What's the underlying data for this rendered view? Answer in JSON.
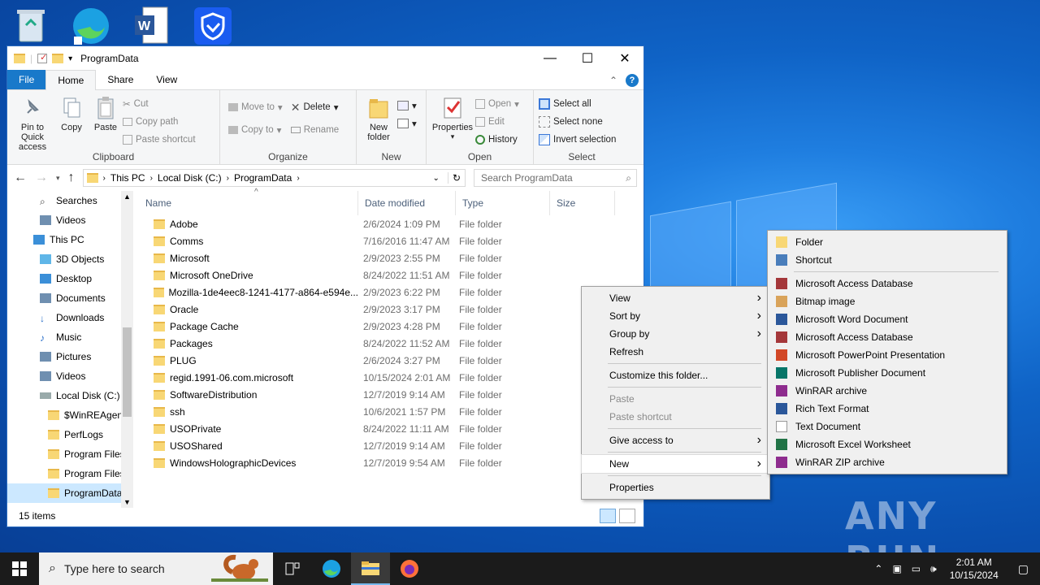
{
  "window": {
    "title": "ProgramData",
    "minimize": "—",
    "maximize": "☐",
    "close": "✕"
  },
  "tabs": {
    "file": "File",
    "home": "Home",
    "share": "Share",
    "view": "View",
    "help": "?"
  },
  "ribbon": {
    "clipboard": {
      "label": "Clipboard",
      "pin": "Pin to Quick access",
      "copy": "Copy",
      "paste": "Paste",
      "cut": "Cut",
      "copy_path": "Copy path",
      "paste_shortcut": "Paste shortcut"
    },
    "organize": {
      "label": "Organize",
      "move_to": "Move to",
      "copy_to": "Copy to",
      "delete": "Delete",
      "rename": "Rename"
    },
    "new": {
      "label": "New",
      "new_folder": "New folder"
    },
    "open": {
      "label": "Open",
      "properties": "Properties",
      "open": "Open",
      "edit": "Edit",
      "history": "History"
    },
    "select": {
      "label": "Select",
      "select_all": "Select all",
      "select_none": "Select none",
      "invert": "Invert selection"
    }
  },
  "address": {
    "crumbs": [
      "This PC",
      "Local Disk (C:)",
      "ProgramData"
    ],
    "search_placeholder": "Search ProgramData"
  },
  "nav": [
    {
      "label": "Searches",
      "indent": 40,
      "icon": "search-icon"
    },
    {
      "label": "Videos",
      "indent": 40,
      "icon": "videos-icon"
    },
    {
      "label": "This PC",
      "indent": 32,
      "icon": "pc-icon"
    },
    {
      "label": "3D Objects",
      "indent": 40,
      "icon": "cube-icon"
    },
    {
      "label": "Desktop",
      "indent": 40,
      "icon": "desktop-icon"
    },
    {
      "label": "Documents",
      "indent": 40,
      "icon": "documents-icon"
    },
    {
      "label": "Downloads",
      "indent": 40,
      "icon": "download-icon"
    },
    {
      "label": "Music",
      "indent": 40,
      "icon": "music-icon"
    },
    {
      "label": "Pictures",
      "indent": 40,
      "icon": "pictures-icon"
    },
    {
      "label": "Videos",
      "indent": 40,
      "icon": "videos-icon"
    },
    {
      "label": "Local Disk (C:)",
      "indent": 40,
      "icon": "drive-icon"
    },
    {
      "label": "$WinREAgent",
      "indent": 50,
      "icon": "folder-icon"
    },
    {
      "label": "PerfLogs",
      "indent": 50,
      "icon": "folder-icon"
    },
    {
      "label": "Program Files",
      "indent": 50,
      "icon": "folder-icon"
    },
    {
      "label": "Program Files",
      "indent": 50,
      "icon": "folder-icon"
    },
    {
      "label": "ProgramData",
      "indent": 50,
      "icon": "folder-icon",
      "selected": true
    }
  ],
  "columns": {
    "name": "Name",
    "date": "Date modified",
    "type": "Type",
    "size": "Size"
  },
  "files": [
    {
      "name": "Adobe",
      "date": "2/6/2024 1:09 PM",
      "type": "File folder"
    },
    {
      "name": "Comms",
      "date": "7/16/2016 11:47 AM",
      "type": "File folder"
    },
    {
      "name": "Microsoft",
      "date": "2/9/2023 2:55 PM",
      "type": "File folder"
    },
    {
      "name": "Microsoft OneDrive",
      "date": "8/24/2022 11:51 AM",
      "type": "File folder"
    },
    {
      "name": "Mozilla-1de4eec8-1241-4177-a864-e594e...",
      "date": "2/9/2023 6:22 PM",
      "type": "File folder"
    },
    {
      "name": "Oracle",
      "date": "2/9/2023 3:17 PM",
      "type": "File folder"
    },
    {
      "name": "Package Cache",
      "date": "2/9/2023 4:28 PM",
      "type": "File folder"
    },
    {
      "name": "Packages",
      "date": "8/24/2022 11:52 AM",
      "type": "File folder"
    },
    {
      "name": "PLUG",
      "date": "2/6/2024 3:27 PM",
      "type": "File folder"
    },
    {
      "name": "regid.1991-06.com.microsoft",
      "date": "10/15/2024 2:01 AM",
      "type": "File folder"
    },
    {
      "name": "SoftwareDistribution",
      "date": "12/7/2019 9:14 AM",
      "type": "File folder"
    },
    {
      "name": "ssh",
      "date": "10/6/2021 1:57 PM",
      "type": "File folder"
    },
    {
      "name": "USOPrivate",
      "date": "8/24/2022 11:11 AM",
      "type": "File folder"
    },
    {
      "name": "USOShared",
      "date": "12/7/2019 9:14 AM",
      "type": "File folder"
    },
    {
      "name": "WindowsHolographicDevices",
      "date": "12/7/2019 9:54 AM",
      "type": "File folder"
    }
  ],
  "status": "15 items",
  "context_menu": [
    {
      "label": "View",
      "arrow": true
    },
    {
      "label": "Sort by",
      "arrow": true
    },
    {
      "label": "Group by",
      "arrow": true
    },
    {
      "label": "Refresh"
    },
    {
      "sep": true
    },
    {
      "label": "Customize this folder..."
    },
    {
      "sep": true
    },
    {
      "label": "Paste",
      "disabled": true
    },
    {
      "label": "Paste shortcut",
      "disabled": true
    },
    {
      "sep": true
    },
    {
      "label": "Give access to",
      "arrow": true
    },
    {
      "sep": true
    },
    {
      "label": "New",
      "arrow": true,
      "highlight": true
    },
    {
      "sep": true
    },
    {
      "label": "Properties"
    }
  ],
  "new_submenu": [
    {
      "label": "Folder",
      "icon": "folder-icon",
      "color": "#f8d775"
    },
    {
      "label": "Shortcut",
      "icon": "shortcut-icon",
      "color": "#4a7ebb"
    },
    {
      "sep": true
    },
    {
      "label": "Microsoft Access Database",
      "icon": "access-icon",
      "color": "#a4373a"
    },
    {
      "label": "Bitmap image",
      "icon": "bitmap-icon",
      "color": "#d9a35a"
    },
    {
      "label": "Microsoft Word Document",
      "icon": "word-icon",
      "color": "#2b579a"
    },
    {
      "label": "Microsoft Access Database",
      "icon": "access-icon",
      "color": "#a4373a"
    },
    {
      "label": "Microsoft PowerPoint Presentation",
      "icon": "powerpoint-icon",
      "color": "#d24726"
    },
    {
      "label": "Microsoft Publisher Document",
      "icon": "publisher-icon",
      "color": "#077568"
    },
    {
      "label": "WinRAR archive",
      "icon": "winrar-icon",
      "color": "#8e2c8e"
    },
    {
      "label": "Rich Text Format",
      "icon": "rtf-icon",
      "color": "#2b579a"
    },
    {
      "label": "Text Document",
      "icon": "text-icon",
      "color": "#bbbbbb"
    },
    {
      "label": "Microsoft Excel Worksheet",
      "icon": "excel-icon",
      "color": "#217346"
    },
    {
      "label": "WinRAR ZIP archive",
      "icon": "winrar-zip-icon",
      "color": "#8e2c8e"
    }
  ],
  "taskbar": {
    "search_placeholder": "Type here to search",
    "time": "2:01 AM",
    "date": "10/15/2024"
  },
  "watermark": "ANY RUN"
}
